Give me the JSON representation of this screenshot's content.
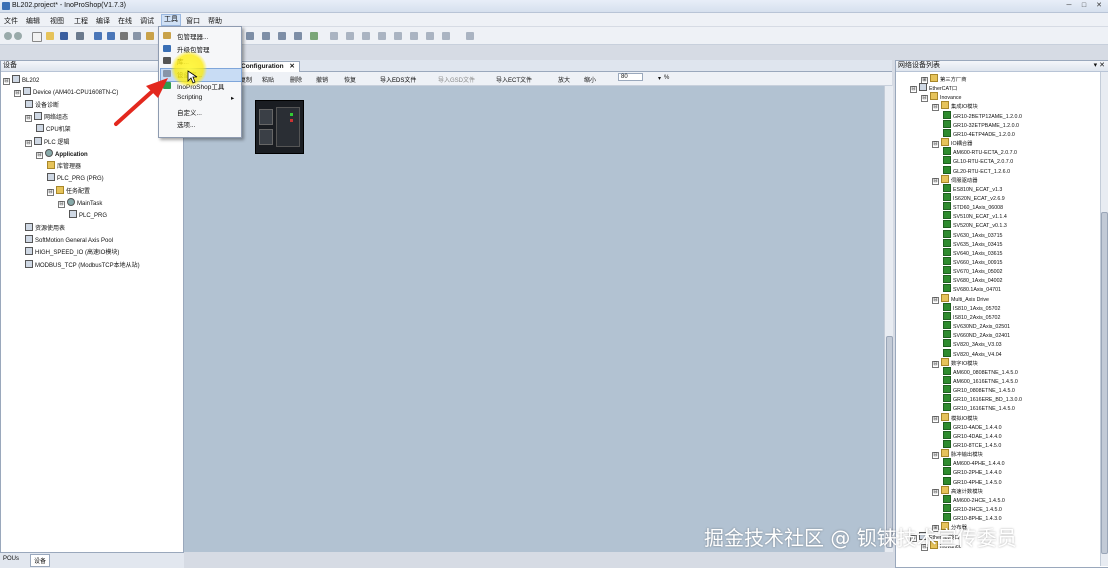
{
  "window": {
    "title": "BL202.project* - InoProShop(V1.7.3)",
    "min_btn": "─",
    "max_btn": "□",
    "close_btn": "✕"
  },
  "menubar": [
    "文件",
    "编辑",
    "视图",
    "工程",
    "编译",
    "在线",
    "调试",
    "工具",
    "窗口",
    "帮助"
  ],
  "tools_menu": {
    "items": [
      {
        "label": "包管理器..."
      },
      {
        "label": "升级包管理"
      },
      {
        "label": "库..."
      },
      {
        "label": "设备库..."
      },
      {
        "label": "InoProShop工具"
      },
      {
        "label": "Scripting",
        "arrow": "▸"
      },
      {
        "label": "自定义..."
      },
      {
        "label": "选项..."
      }
    ],
    "selected_index": 3
  },
  "left_panel": {
    "title": "设备",
    "pin": "▾ ✕",
    "tree": [
      {
        "label": "BL202",
        "depth": 0,
        "icon": "project-icon",
        "exp": "⊟"
      },
      {
        "label": "Device (AM401-CPU1608TN-C)",
        "depth": 1,
        "icon": "device-icon",
        "exp": "⊟"
      },
      {
        "label": "设备诊断",
        "depth": 2,
        "icon": "diagnostic-icon",
        "exp": ""
      },
      {
        "label": "网络组态",
        "depth": 2,
        "icon": "network-icon",
        "exp": "⊟"
      },
      {
        "label": "CPU机架",
        "depth": 3,
        "icon": "rack-icon",
        "exp": ""
      },
      {
        "label": "PLC 逻辑",
        "depth": 2,
        "icon": "plc-icon",
        "exp": "⊟"
      },
      {
        "label": "Application",
        "depth": 3,
        "icon": "gear-icon",
        "exp": "⊟"
      },
      {
        "label": "库管理器",
        "depth": 4,
        "icon": "library-icon",
        "exp": ""
      },
      {
        "label": "PLC_PRG (PRG)",
        "depth": 4,
        "icon": "program-icon",
        "exp": ""
      },
      {
        "label": "任务配置",
        "depth": 4,
        "icon": "task-icon",
        "exp": "⊟"
      },
      {
        "label": "MainTask",
        "depth": 5,
        "icon": "gear-icon",
        "exp": "⊟"
      },
      {
        "label": "PLC_PRG",
        "depth": 6,
        "icon": "program-icon",
        "exp": ""
      },
      {
        "label": "资源使用表",
        "depth": 2,
        "icon": "table-icon",
        "exp": ""
      },
      {
        "label": "SoftMotion General Axis Pool",
        "depth": 2,
        "icon": "axis-icon",
        "exp": ""
      },
      {
        "label": "HIGH_SPEED_IO (高速IO模块)",
        "depth": 2,
        "icon": "io-icon",
        "exp": ""
      },
      {
        "label": "MODBUS_TCP (ModbusTCP本地从站)",
        "depth": 2,
        "icon": "modbus-icon",
        "exp": ""
      }
    ],
    "bottom_tabs": [
      "POUs",
      "设备"
    ]
  },
  "center": {
    "tab_label": "Configuration",
    "tab_close": "✕",
    "toolbar": [
      "复制",
      "粘贴",
      "删除",
      "撤销",
      "恢复",
      "导入EDS文件",
      "导入GSD文件",
      "导入ECT文件",
      "放大",
      "缩小",
      "80",
      "%"
    ]
  },
  "right_panel": {
    "title": "网络设备列表",
    "pin": "▾ ✕",
    "tree": [
      {
        "label": "第三方厂商",
        "depth": 1,
        "kind": "folder",
        "exp": "⊞"
      },
      {
        "label": "EtherCAT口",
        "depth": 0,
        "kind": "net",
        "exp": "⊟"
      },
      {
        "label": "Inovance",
        "depth": 1,
        "kind": "folder",
        "exp": "⊟"
      },
      {
        "label": "集成IO模块",
        "depth": 2,
        "kind": "folder",
        "exp": "⊟"
      },
      {
        "label": "GR10-2BETP12AME_1.2.0.0",
        "depth": 3,
        "kind": "dev",
        "exp": ""
      },
      {
        "label": "GR10-32ETPBAME_1.2.0.0",
        "depth": 3,
        "kind": "dev",
        "exp": ""
      },
      {
        "label": "GR10-4ETP4ADE_1.2.0.0",
        "depth": 3,
        "kind": "dev",
        "exp": ""
      },
      {
        "label": "IO耦合器",
        "depth": 2,
        "kind": "folder",
        "exp": "⊟"
      },
      {
        "label": "AM600-RTU-ECTA_2.0.7.0",
        "depth": 3,
        "kind": "dev",
        "exp": ""
      },
      {
        "label": "GL10-RTU-ECTA_2.0.7.0",
        "depth": 3,
        "kind": "dev",
        "exp": ""
      },
      {
        "label": "GL20-RTU-ECT_1.2.6.0",
        "depth": 3,
        "kind": "dev",
        "exp": ""
      },
      {
        "label": "伺服驱动器",
        "depth": 2,
        "kind": "folder",
        "exp": "⊟"
      },
      {
        "label": "ES810N_ECAT_v1.3",
        "depth": 3,
        "kind": "dev",
        "exp": ""
      },
      {
        "label": "IS620N_ECAT_v2.6.9",
        "depth": 3,
        "kind": "dev",
        "exp": ""
      },
      {
        "label": "STD60_1Axis_06008",
        "depth": 3,
        "kind": "dev",
        "exp": ""
      },
      {
        "label": "SV510N_ECAT_v1.1.4",
        "depth": 3,
        "kind": "dev",
        "exp": ""
      },
      {
        "label": "SV520N_ECAT_v0.1.3",
        "depth": 3,
        "kind": "dev",
        "exp": ""
      },
      {
        "label": "SV630_1Axis_03715",
        "depth": 3,
        "kind": "dev",
        "exp": ""
      },
      {
        "label": "SV635_1Axis_03415",
        "depth": 3,
        "kind": "dev",
        "exp": ""
      },
      {
        "label": "SV640_1Axis_03615",
        "depth": 3,
        "kind": "dev",
        "exp": ""
      },
      {
        "label": "SV660_1Axis_00915",
        "depth": 3,
        "kind": "dev",
        "exp": ""
      },
      {
        "label": "SV670_1Axis_05002",
        "depth": 3,
        "kind": "dev",
        "exp": ""
      },
      {
        "label": "SV680_1Axis_04002",
        "depth": 3,
        "kind": "dev",
        "exp": ""
      },
      {
        "label": "SV680.1Axis_04701",
        "depth": 3,
        "kind": "dev",
        "exp": ""
      },
      {
        "label": "Multi_Axis Drive",
        "depth": 2,
        "kind": "folder",
        "exp": "⊟"
      },
      {
        "label": "IS810_1Axis_05702",
        "depth": 3,
        "kind": "dev",
        "exp": ""
      },
      {
        "label": "IS810_2Axis_05702",
        "depth": 3,
        "kind": "dev",
        "exp": ""
      },
      {
        "label": "SV630ND_2Axis_02501",
        "depth": 3,
        "kind": "dev",
        "exp": ""
      },
      {
        "label": "SV660ND_2Axis_02401",
        "depth": 3,
        "kind": "dev",
        "exp": ""
      },
      {
        "label": "SV820_3Axis_V3.03",
        "depth": 3,
        "kind": "dev",
        "exp": ""
      },
      {
        "label": "SV820_4Axis_V4.04",
        "depth": 3,
        "kind": "dev",
        "exp": ""
      },
      {
        "label": "数字IO模块",
        "depth": 2,
        "kind": "folder",
        "exp": "⊟"
      },
      {
        "label": "AM600_0808ETNE_1.4.5.0",
        "depth": 3,
        "kind": "dev",
        "exp": ""
      },
      {
        "label": "AM600_1616ETNE_1.4.5.0",
        "depth": 3,
        "kind": "dev",
        "exp": ""
      },
      {
        "label": "GR10_0808ETNE_1.4.5.0",
        "depth": 3,
        "kind": "dev",
        "exp": ""
      },
      {
        "label": "GR10_1616ERE_BD_1.3.0.0",
        "depth": 3,
        "kind": "dev",
        "exp": ""
      },
      {
        "label": "GR10_1616ETNE_1.4.5.0",
        "depth": 3,
        "kind": "dev",
        "exp": ""
      },
      {
        "label": "模拟IO模块",
        "depth": 2,
        "kind": "folder",
        "exp": "⊟"
      },
      {
        "label": "GR10-4ADE_1.4.4.0",
        "depth": 3,
        "kind": "dev",
        "exp": ""
      },
      {
        "label": "GR10-4DAE_1.4.4.0",
        "depth": 3,
        "kind": "dev",
        "exp": ""
      },
      {
        "label": "GR10-8TCE_1.4.5.0",
        "depth": 3,
        "kind": "dev",
        "exp": ""
      },
      {
        "label": "脉冲输出模块",
        "depth": 2,
        "kind": "folder",
        "exp": "⊟"
      },
      {
        "label": "AM600-4PHE_1.4.4.0",
        "depth": 3,
        "kind": "dev",
        "exp": ""
      },
      {
        "label": "GR10-2PHE_1.4.4.0",
        "depth": 3,
        "kind": "dev",
        "exp": ""
      },
      {
        "label": "GR10-4PHE_1.4.5.0",
        "depth": 3,
        "kind": "dev",
        "exp": ""
      },
      {
        "label": "高速计数模块",
        "depth": 2,
        "kind": "folder",
        "exp": "⊟"
      },
      {
        "label": "AM600-2HCE_1.4.5.0",
        "depth": 3,
        "kind": "dev",
        "exp": ""
      },
      {
        "label": "GR10-2HCE_1.4.5.0",
        "depth": 3,
        "kind": "dev",
        "exp": ""
      },
      {
        "label": "GR10-8PHE_1.4.3.0",
        "depth": 3,
        "kind": "dev",
        "exp": ""
      },
      {
        "label": "分布器",
        "depth": 2,
        "kind": "folder",
        "exp": "⊞"
      },
      {
        "label": "Ethernet接口",
        "depth": 0,
        "kind": "net",
        "exp": "⊟"
      },
      {
        "label": "Inovance",
        "depth": 1,
        "kind": "folder",
        "exp": "⊟"
      }
    ]
  },
  "watermark": "掘金技术社区 @ 钡铼技术宣传委员"
}
